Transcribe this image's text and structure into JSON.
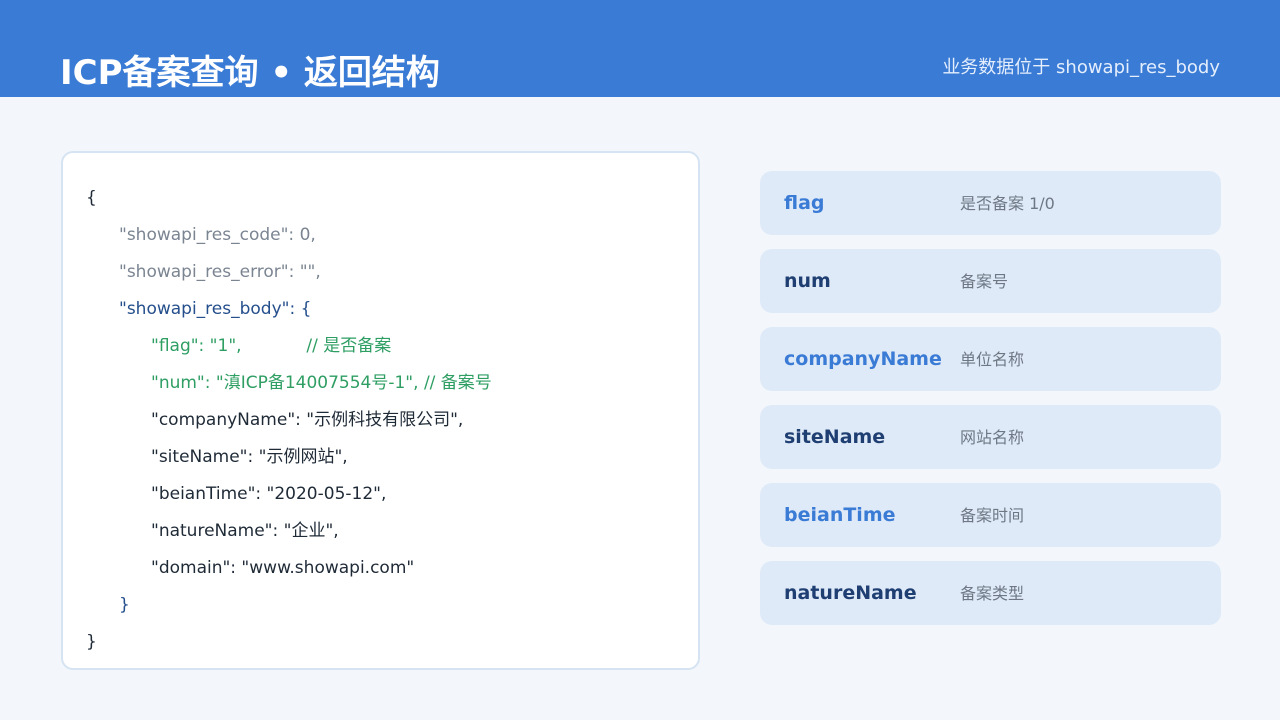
{
  "header": {
    "title": "ICP备案查询 • 返回结构",
    "subtitle": "业务数据位于 showapi_res_body",
    "background_color": "#3a7bd5"
  },
  "code": {
    "lines": [
      {
        "text": "{",
        "color": "#1f2a37"
      },
      {
        "text": "\"showapi_res_code\": 0,",
        "color": "#7b8592"
      },
      {
        "text": "\"showapi_res_error\": \"\",",
        "color": "#7b8592"
      },
      {
        "text": "\"showapi_res_body\": {",
        "color": "#244f8c"
      },
      {
        "text": "\"flag\": \"1\",            // 是否备案",
        "color": "#2e9e63"
      },
      {
        "text": "\"num\": \"滇ICP备14007554号-1\", // 备案号",
        "color": "#2e9e63"
      },
      {
        "text": "\"companyName\": \"示例科技有限公司\",",
        "color": "#1f2a37"
      },
      {
        "text": "\"siteName\": \"示例网站\",",
        "color": "#1f2a37"
      },
      {
        "text": "\"beianTime\": \"2020-05-12\",",
        "color": "#1f2a37"
      },
      {
        "text": "\"natureName\": \"企业\",",
        "color": "#1f2a37"
      },
      {
        "text": "\"domain\": \"www.showapi.com\"",
        "color": "#1f2a37"
      },
      {
        "text": "}",
        "color": "#244f8c"
      },
      {
        "text": "}",
        "color": "#1f2a37"
      }
    ]
  },
  "fields": [
    {
      "key": "flag",
      "desc": "是否备案 1/0",
      "color": "#3a7bd5"
    },
    {
      "key": "num",
      "desc": "备案号",
      "color": "#1f3f73"
    },
    {
      "key": "companyName",
      "desc": "单位名称",
      "color": "#3a7bd5"
    },
    {
      "key": "siteName",
      "desc": "网站名称",
      "color": "#1f3f73"
    },
    {
      "key": "beianTime",
      "desc": "备案时间",
      "color": "#3a7bd5"
    },
    {
      "key": "natureName",
      "desc": "备案类型",
      "color": "#1f3f73"
    }
  ]
}
